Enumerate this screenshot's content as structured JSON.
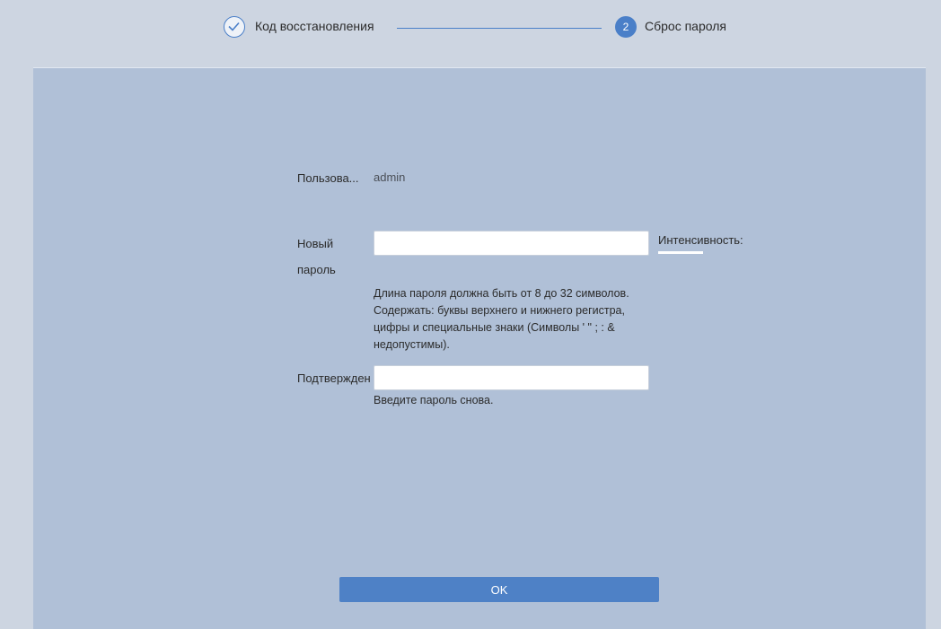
{
  "steps": {
    "step1": {
      "label": "Код восстановления"
    },
    "step2": {
      "number": "2",
      "label": "Сброс пароля"
    }
  },
  "form": {
    "user": {
      "label": "Пользова...",
      "value": "admin"
    },
    "new_password": {
      "label_line1": "Новый",
      "label_line2": "пароль",
      "value": "",
      "strength_label": "Интенсивность:",
      "strength_level": 0,
      "hint": "Длина пароля должна быть от 8 до 32 символов. Содержать: буквы верхнего и нижнего регистра, цифры и специальные знаки (Символы ' \" ; : & недопустимы)."
    },
    "confirm": {
      "label": "Подтвержден",
      "value": "",
      "hint": "Введите пароль снова."
    }
  },
  "actions": {
    "ok_label": "OK"
  },
  "colors": {
    "accent": "#4e81c6",
    "panel": "#b0c0d7",
    "background": "#cdd5e1"
  }
}
